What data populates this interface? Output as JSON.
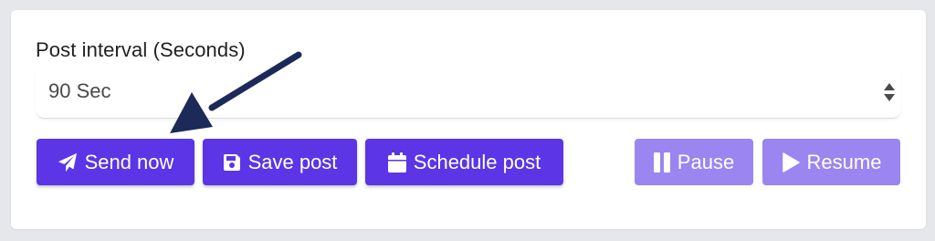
{
  "interval": {
    "label": "Post interval (Seconds)",
    "value": "90 Sec"
  },
  "buttons": {
    "send_now": "Send now",
    "save_post": "Save post",
    "schedule_post": "Schedule post",
    "pause": "Pause",
    "resume": "Resume"
  },
  "icons": {
    "send_now": "paper-plane-icon",
    "save_post": "floppy-disk-icon",
    "schedule_post": "calendar-icon",
    "pause": "pause-icon",
    "resume": "play-icon",
    "select": "sort-arrows-icon"
  },
  "colors": {
    "primary": "#5b35e6",
    "disabled": "#9b85f0",
    "annotation_arrow": "#1c2a5a"
  }
}
